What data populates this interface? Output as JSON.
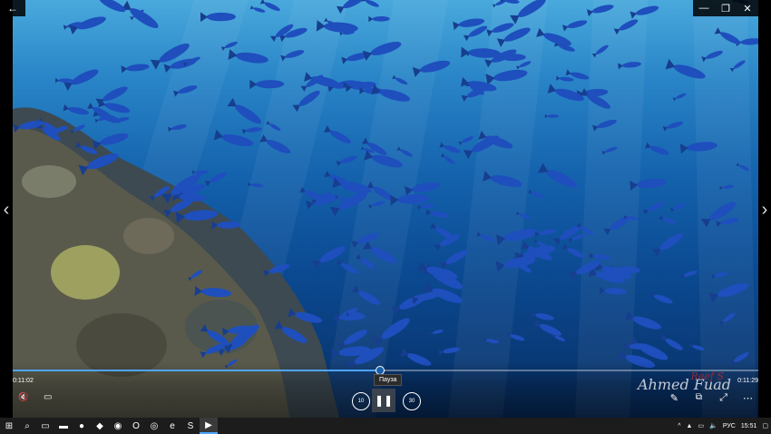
{
  "window": {
    "back_glyph": "←",
    "minimize_glyph": "—",
    "maximize_glyph": "❐",
    "close_glyph": "✕"
  },
  "nav": {
    "prev_glyph": "‹",
    "next_glyph": "›"
  },
  "player": {
    "current_time": "0:11:02",
    "total_time": "0:11:29",
    "progress_fraction": 0.493,
    "tooltip": "Пауза",
    "play_glyph": "❚❚",
    "skip_back_label": "10",
    "skip_forward_label": "30",
    "mute_glyph": "🔇",
    "subtitles_glyph": "▭",
    "edit_glyph": "✎",
    "cast_glyph": "⧉",
    "fullscreen_glyph": "⤢",
    "more_glyph": "⋯",
    "watermark_text": "Ahmed Fuad",
    "watermark_red": "Reef S"
  },
  "taskbar": {
    "items": [
      {
        "icon": "windows-start-icon",
        "glyph": "⊞"
      },
      {
        "icon": "search-icon",
        "glyph": "⌕"
      },
      {
        "icon": "task-view-icon",
        "glyph": "▭"
      },
      {
        "icon": "file-explorer-icon",
        "glyph": "▬"
      },
      {
        "icon": "firefox-icon",
        "glyph": "●"
      },
      {
        "icon": "app-icon",
        "glyph": "◆"
      },
      {
        "icon": "app-icon-2",
        "glyph": "◉"
      },
      {
        "icon": "opera-icon",
        "glyph": "O"
      },
      {
        "icon": "chrome-icon",
        "glyph": "◎"
      },
      {
        "icon": "edge-icon",
        "glyph": "e"
      },
      {
        "icon": "skype-icon",
        "glyph": "S"
      },
      {
        "icon": "movies-tv-icon",
        "glyph": "▶"
      }
    ],
    "tray": {
      "chevron": "^",
      "network_glyph": "▲",
      "battery_glyph": "▭",
      "volume_glyph": "🔈",
      "language": "РУС",
      "clock": "15:51",
      "notification_glyph": "▢"
    }
  },
  "colors": {
    "accent": "#4ea5ff",
    "water_top": "#49a9dc",
    "water_deep": "#062c5e",
    "fish": "#1e4fbd"
  }
}
